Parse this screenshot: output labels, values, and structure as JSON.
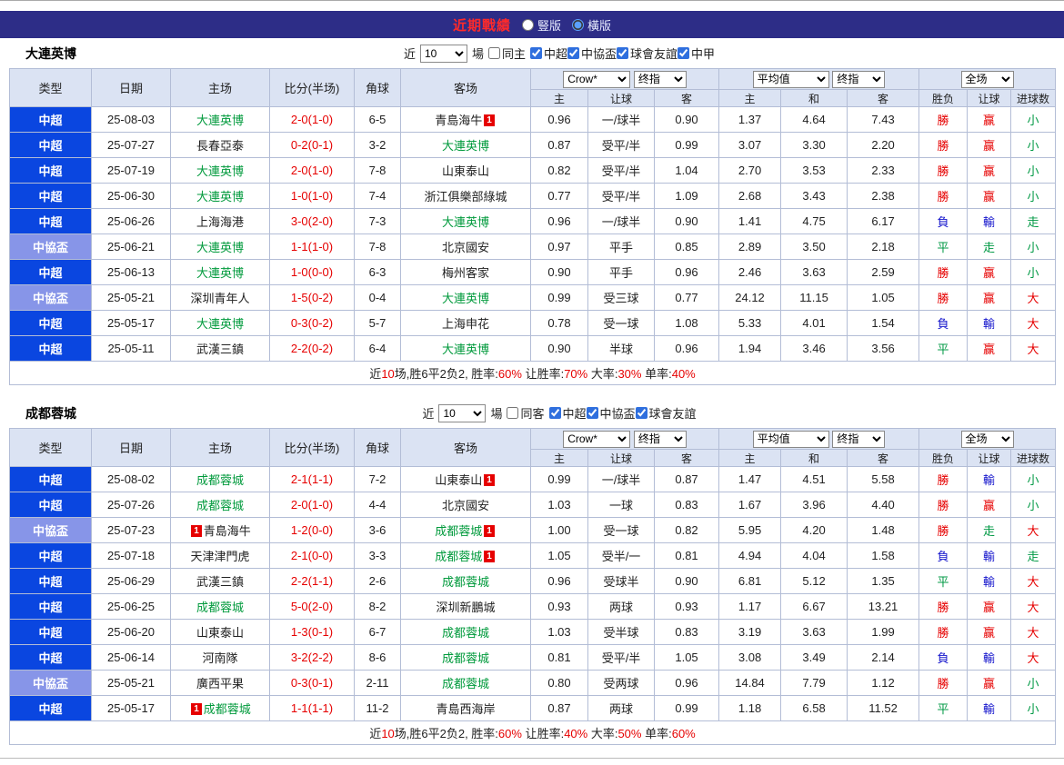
{
  "titlebar": {
    "title": "近期戰績",
    "radio_vertical": "豎版",
    "radio_horizontal": "橫版"
  },
  "colors": {
    "titlebar_bg": "#2d2d87",
    "title_red": "#ff2a2a",
    "header_bg": "#dbe3f3",
    "super_league_bg": "#0a46e0",
    "cup_bg": "#8795e8",
    "self_team_green": "#019a3c",
    "win_red": "#e60000",
    "lose_blue": "#1515cc",
    "draw_green": "#009944"
  },
  "filter_labels": {
    "near": "近",
    "near_value": "10",
    "games": "場"
  },
  "table_header": {
    "type": "类型",
    "date": "日期",
    "home": "主场",
    "score": "比分(半场)",
    "corner": "角球",
    "away": "客场",
    "book_select": "Crow*",
    "final_select_1": "终指",
    "avg_select": "平均值",
    "final_select_2": "终指",
    "fulltime_select": "全场",
    "sub": {
      "home_odds": "主",
      "handicap": "让球",
      "away_odds": "客",
      "avg_home": "主",
      "avg_draw": "和",
      "avg_away": "客",
      "wdl": "胜负",
      "ah": "让球",
      "goals": "进球数"
    }
  },
  "sections": [
    {
      "team": "大連英博",
      "same_label": "同主",
      "same_checked": false,
      "leagues": [
        {
          "label": "中超",
          "checked": true
        },
        {
          "label": "中協盃",
          "checked": true
        },
        {
          "label": "球會友誼",
          "checked": true
        },
        {
          "label": "中甲",
          "checked": true
        }
      ],
      "rows": [
        {
          "league": "中超",
          "cup": false,
          "date": "25-08-03",
          "home": "大連英博",
          "home_self": true,
          "home_badge": null,
          "score": "2-0(1-0)",
          "corner": "6-5",
          "away": "青島海牛",
          "away_self": false,
          "away_badge": "after",
          "odds": [
            "0.96",
            "一/球半",
            "0.90"
          ],
          "avg": [
            "1.37",
            "4.64",
            "7.43"
          ],
          "results": [
            "勝",
            "赢",
            "小"
          ]
        },
        {
          "league": "中超",
          "cup": false,
          "date": "25-07-27",
          "home": "長春亞泰",
          "home_self": false,
          "home_badge": null,
          "score": "0-2(0-1)",
          "corner": "3-2",
          "away": "大連英博",
          "away_self": true,
          "away_badge": null,
          "odds": [
            "0.87",
            "受平/半",
            "0.99"
          ],
          "avg": [
            "3.07",
            "3.30",
            "2.20"
          ],
          "results": [
            "勝",
            "赢",
            "小"
          ]
        },
        {
          "league": "中超",
          "cup": false,
          "date": "25-07-19",
          "home": "大連英博",
          "home_self": true,
          "home_badge": null,
          "score": "2-0(1-0)",
          "corner": "7-8",
          "away": "山東泰山",
          "away_self": false,
          "away_badge": null,
          "odds": [
            "0.82",
            "受平/半",
            "1.04"
          ],
          "avg": [
            "2.70",
            "3.53",
            "2.33"
          ],
          "results": [
            "勝",
            "赢",
            "小"
          ]
        },
        {
          "league": "中超",
          "cup": false,
          "date": "25-06-30",
          "home": "大連英博",
          "home_self": true,
          "home_badge": null,
          "score": "1-0(1-0)",
          "corner": "7-4",
          "away": "浙江俱樂部綠城",
          "away_self": false,
          "away_badge": null,
          "odds": [
            "0.77",
            "受平/半",
            "1.09"
          ],
          "avg": [
            "2.68",
            "3.43",
            "2.38"
          ],
          "results": [
            "勝",
            "赢",
            "小"
          ]
        },
        {
          "league": "中超",
          "cup": false,
          "date": "25-06-26",
          "home": "上海海港",
          "home_self": false,
          "home_badge": null,
          "score": "3-0(2-0)",
          "corner": "7-3",
          "away": "大連英博",
          "away_self": true,
          "away_badge": null,
          "odds": [
            "0.96",
            "一/球半",
            "0.90"
          ],
          "avg": [
            "1.41",
            "4.75",
            "6.17"
          ],
          "results": [
            "負",
            "輸",
            "走"
          ]
        },
        {
          "league": "中協盃",
          "cup": true,
          "date": "25-06-21",
          "home": "大連英博",
          "home_self": true,
          "home_badge": null,
          "score": "1-1(1-0)",
          "corner": "7-8",
          "away": "北京國安",
          "away_self": false,
          "away_badge": null,
          "odds": [
            "0.97",
            "平手",
            "0.85"
          ],
          "avg": [
            "2.89",
            "3.50",
            "2.18"
          ],
          "results": [
            "平",
            "走",
            "小"
          ]
        },
        {
          "league": "中超",
          "cup": false,
          "date": "25-06-13",
          "home": "大連英博",
          "home_self": true,
          "home_badge": null,
          "score": "1-0(0-0)",
          "corner": "6-3",
          "away": "梅州客家",
          "away_self": false,
          "away_badge": null,
          "odds": [
            "0.90",
            "平手",
            "0.96"
          ],
          "avg": [
            "2.46",
            "3.63",
            "2.59"
          ],
          "results": [
            "勝",
            "赢",
            "小"
          ]
        },
        {
          "league": "中協盃",
          "cup": true,
          "date": "25-05-21",
          "home": "深圳青年人",
          "home_self": false,
          "home_badge": null,
          "score": "1-5(0-2)",
          "corner": "0-4",
          "away": "大連英博",
          "away_self": true,
          "away_badge": null,
          "odds": [
            "0.99",
            "受三球",
            "0.77"
          ],
          "avg": [
            "24.12",
            "11.15",
            "1.05"
          ],
          "results": [
            "勝",
            "赢",
            "大"
          ]
        },
        {
          "league": "中超",
          "cup": false,
          "date": "25-05-17",
          "home": "大連英博",
          "home_self": true,
          "home_badge": null,
          "score": "0-3(0-2)",
          "corner": "5-7",
          "away": "上海申花",
          "away_self": false,
          "away_badge": null,
          "odds": [
            "0.78",
            "受一球",
            "1.08"
          ],
          "avg": [
            "5.33",
            "4.01",
            "1.54"
          ],
          "results": [
            "負",
            "輸",
            "大"
          ]
        },
        {
          "league": "中超",
          "cup": false,
          "date": "25-05-11",
          "home": "武漢三鎮",
          "home_self": false,
          "home_badge": null,
          "score": "2-2(0-2)",
          "corner": "6-4",
          "away": "大連英博",
          "away_self": true,
          "away_badge": null,
          "odds": [
            "0.90",
            "半球",
            "0.96"
          ],
          "avg": [
            "1.94",
            "3.46",
            "3.56"
          ],
          "results": [
            "平",
            "赢",
            "大"
          ]
        }
      ],
      "summary": [
        {
          "text": "近"
        },
        {
          "text": "10",
          "red": true
        },
        {
          "text": "场,胜6平2负2, 胜率:"
        },
        {
          "text": "60%",
          "red": true
        },
        {
          "text": " 让胜率:"
        },
        {
          "text": "70%",
          "red": true
        },
        {
          "text": " 大率:"
        },
        {
          "text": "30%",
          "red": true
        },
        {
          "text": " 单率:"
        },
        {
          "text": "40%",
          "red": true
        }
      ]
    },
    {
      "team": "成都蓉城",
      "same_label": "同客",
      "same_checked": false,
      "leagues": [
        {
          "label": "中超",
          "checked": true
        },
        {
          "label": "中協盃",
          "checked": true
        },
        {
          "label": "球會友誼",
          "checked": true
        }
      ],
      "rows": [
        {
          "league": "中超",
          "cup": false,
          "date": "25-08-02",
          "home": "成都蓉城",
          "home_self": true,
          "home_badge": null,
          "score": "2-1(1-1)",
          "corner": "7-2",
          "away": "山東泰山",
          "away_self": false,
          "away_badge": "after",
          "odds": [
            "0.99",
            "一/球半",
            "0.87"
          ],
          "avg": [
            "1.47",
            "4.51",
            "5.58"
          ],
          "results": [
            "勝",
            "輸",
            "小"
          ]
        },
        {
          "league": "中超",
          "cup": false,
          "date": "25-07-26",
          "home": "成都蓉城",
          "home_self": true,
          "home_badge": null,
          "score": "2-0(1-0)",
          "corner": "4-4",
          "away": "北京國安",
          "away_self": false,
          "away_badge": null,
          "odds": [
            "1.03",
            "一球",
            "0.83"
          ],
          "avg": [
            "1.67",
            "3.96",
            "4.40"
          ],
          "results": [
            "勝",
            "赢",
            "小"
          ]
        },
        {
          "league": "中協盃",
          "cup": true,
          "date": "25-07-23",
          "home": "青島海牛",
          "home_self": false,
          "home_badge": "before",
          "score": "1-2(0-0)",
          "corner": "3-6",
          "away": "成都蓉城",
          "away_self": true,
          "away_badge": "after",
          "odds": [
            "1.00",
            "受一球",
            "0.82"
          ],
          "avg": [
            "5.95",
            "4.20",
            "1.48"
          ],
          "results": [
            "勝",
            "走",
            "大"
          ]
        },
        {
          "league": "中超",
          "cup": false,
          "date": "25-07-18",
          "home": "天津津門虎",
          "home_self": false,
          "home_badge": null,
          "score": "2-1(0-0)",
          "corner": "3-3",
          "away": "成都蓉城",
          "away_self": true,
          "away_badge": "after",
          "odds": [
            "1.05",
            "受半/一",
            "0.81"
          ],
          "avg": [
            "4.94",
            "4.04",
            "1.58"
          ],
          "results": [
            "負",
            "輸",
            "走"
          ]
        },
        {
          "league": "中超",
          "cup": false,
          "date": "25-06-29",
          "home": "武漢三鎮",
          "home_self": false,
          "home_badge": null,
          "score": "2-2(1-1)",
          "corner": "2-6",
          "away": "成都蓉城",
          "away_self": true,
          "away_badge": null,
          "odds": [
            "0.96",
            "受球半",
            "0.90"
          ],
          "avg": [
            "6.81",
            "5.12",
            "1.35"
          ],
          "results": [
            "平",
            "輸",
            "大"
          ]
        },
        {
          "league": "中超",
          "cup": false,
          "date": "25-06-25",
          "home": "成都蓉城",
          "home_self": true,
          "home_badge": null,
          "score": "5-0(2-0)",
          "corner": "8-2",
          "away": "深圳新鵬城",
          "away_self": false,
          "away_badge": null,
          "odds": [
            "0.93",
            "两球",
            "0.93"
          ],
          "avg": [
            "1.17",
            "6.67",
            "13.21"
          ],
          "results": [
            "勝",
            "赢",
            "大"
          ]
        },
        {
          "league": "中超",
          "cup": false,
          "date": "25-06-20",
          "home": "山東泰山",
          "home_self": false,
          "home_badge": null,
          "score": "1-3(0-1)",
          "corner": "6-7",
          "away": "成都蓉城",
          "away_self": true,
          "away_badge": null,
          "odds": [
            "1.03",
            "受半球",
            "0.83"
          ],
          "avg": [
            "3.19",
            "3.63",
            "1.99"
          ],
          "results": [
            "勝",
            "赢",
            "大"
          ]
        },
        {
          "league": "中超",
          "cup": false,
          "date": "25-06-14",
          "home": "河南隊",
          "home_self": false,
          "home_badge": null,
          "score": "3-2(2-2)",
          "corner": "8-6",
          "away": "成都蓉城",
          "away_self": true,
          "away_badge": null,
          "odds": [
            "0.81",
            "受平/半",
            "1.05"
          ],
          "avg": [
            "3.08",
            "3.49",
            "2.14"
          ],
          "results": [
            "負",
            "輸",
            "大"
          ]
        },
        {
          "league": "中協盃",
          "cup": true,
          "date": "25-05-21",
          "home": "廣西平果",
          "home_self": false,
          "home_badge": null,
          "score": "0-3(0-1)",
          "corner": "2-11",
          "away": "成都蓉城",
          "away_self": true,
          "away_badge": null,
          "odds": [
            "0.80",
            "受两球",
            "0.96"
          ],
          "avg": [
            "14.84",
            "7.79",
            "1.12"
          ],
          "results": [
            "勝",
            "赢",
            "小"
          ]
        },
        {
          "league": "中超",
          "cup": false,
          "date": "25-05-17",
          "home": "成都蓉城",
          "home_self": true,
          "home_badge": "before",
          "score": "1-1(1-1)",
          "corner": "11-2",
          "away": "青島西海岸",
          "away_self": false,
          "away_badge": null,
          "odds": [
            "0.87",
            "两球",
            "0.99"
          ],
          "avg": [
            "1.18",
            "6.58",
            "11.52"
          ],
          "results": [
            "平",
            "輸",
            "小"
          ]
        }
      ],
      "summary": [
        {
          "text": "近"
        },
        {
          "text": "10",
          "red": true
        },
        {
          "text": "场,胜6平2负2, 胜率:"
        },
        {
          "text": "60%",
          "red": true
        },
        {
          "text": " 让胜率:"
        },
        {
          "text": "40%",
          "red": true
        },
        {
          "text": " 大率:"
        },
        {
          "text": "50%",
          "red": true
        },
        {
          "text": " 单率:"
        },
        {
          "text": "60%",
          "red": true
        }
      ]
    }
  ]
}
